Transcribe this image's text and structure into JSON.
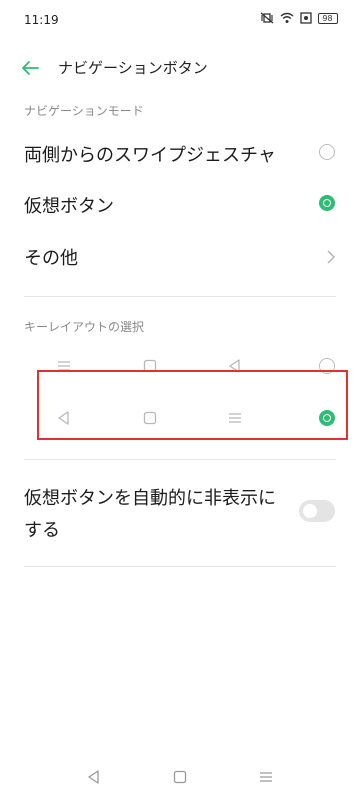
{
  "status_bar": {
    "time": "11:19",
    "battery": "98"
  },
  "header": {
    "title": "ナビゲーションボタン"
  },
  "section_mode": {
    "label": "ナビゲーションモード"
  },
  "modes": [
    {
      "label": "両側からのスワイプジェスチャ",
      "selected": false
    },
    {
      "label": "仮想ボタン",
      "selected": true
    },
    {
      "label": "その他",
      "type": "link"
    }
  ],
  "section_layout": {
    "label": "キーレイアウトの選択"
  },
  "layouts": [
    {
      "keys": [
        "menu",
        "home",
        "back"
      ],
      "selected": false
    },
    {
      "keys": [
        "back",
        "home",
        "menu"
      ],
      "selected": true
    }
  ],
  "auto_hide": {
    "line1": "仮想ボタンを自動的に非表示に",
    "line2": "する",
    "enabled": false
  },
  "colors": {
    "accent": "#2ebd74",
    "highlight": "#e0332f"
  }
}
